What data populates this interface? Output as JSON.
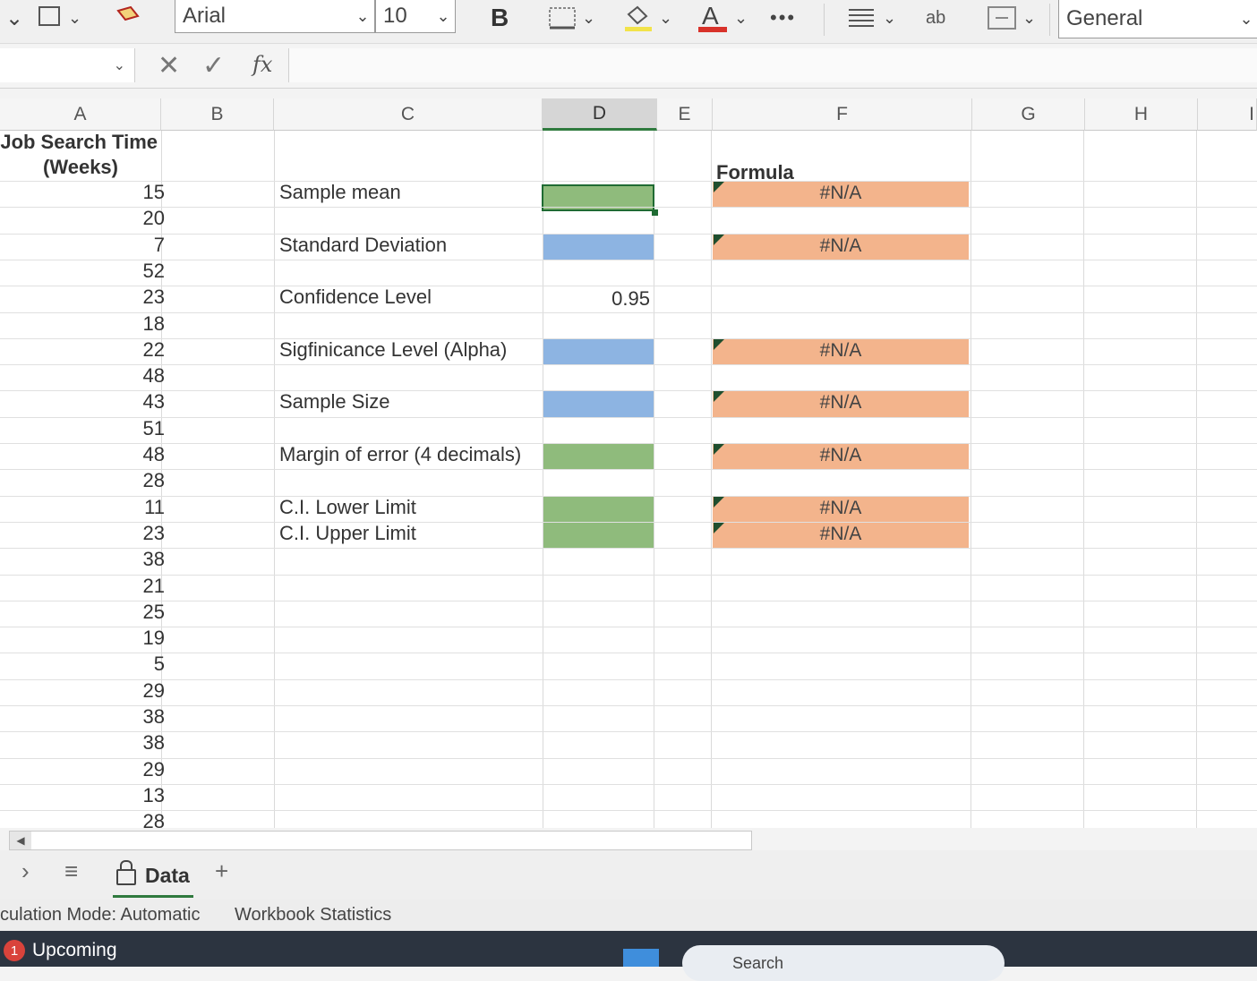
{
  "ribbon": {
    "font_name": "Arial",
    "font_size": "10",
    "bold_label": "B",
    "more_label": "•••",
    "wrap_label": "ab",
    "number_format": "General"
  },
  "formula_bar": {
    "fx_label": "fx",
    "value": ""
  },
  "columns": [
    "A",
    "B",
    "C",
    "D",
    "E",
    "F",
    "G",
    "H",
    "I"
  ],
  "column_a_header": [
    "Job Search Time",
    "(Weeks)"
  ],
  "job_search_weeks": [
    15,
    20,
    7,
    52,
    23,
    18,
    22,
    48,
    43,
    51,
    48,
    28,
    11,
    23,
    38,
    21,
    25,
    19,
    5,
    29,
    38,
    38,
    29,
    13,
    28
  ],
  "formula_header": "Formula",
  "stats": [
    {
      "label": "Sample mean",
      "value": "",
      "fill": "green",
      "formula": "#N/A"
    },
    {
      "label": "Standard Deviation",
      "value": "",
      "fill": "blue",
      "formula": "#N/A"
    },
    {
      "label": "Confidence Level",
      "value": "0.95",
      "fill": "none",
      "formula": ""
    },
    {
      "label": "Sigfinicance Level (Alpha)",
      "value": "",
      "fill": "blue",
      "formula": "#N/A"
    },
    {
      "label": "Sample Size",
      "value": "",
      "fill": "blue",
      "formula": "#N/A"
    },
    {
      "label": "Margin of error (4 decimals)",
      "value": "",
      "fill": "green",
      "formula": "#N/A"
    },
    {
      "label": "C.I. Lower Limit",
      "value": "",
      "fill": "green",
      "formula": "#N/A"
    },
    {
      "label": "C.I. Upper Limit",
      "value": "",
      "fill": "green",
      "formula": "#N/A"
    }
  ],
  "colors": {
    "input_fill": "#8db4e2",
    "output_fill": "#8fbb7c",
    "formula_fill": "#f3b48c",
    "accent": "#2f7a3e"
  },
  "sheet_tabs": {
    "active": "Data",
    "add_label": "+"
  },
  "status_bar": {
    "calc_mode": "culation Mode: Automatic",
    "workbook_stats": "Workbook Statistics"
  },
  "taskbar": {
    "notification_count": "1",
    "upcoming_label": "Upcoming",
    "search_label": "Search"
  }
}
